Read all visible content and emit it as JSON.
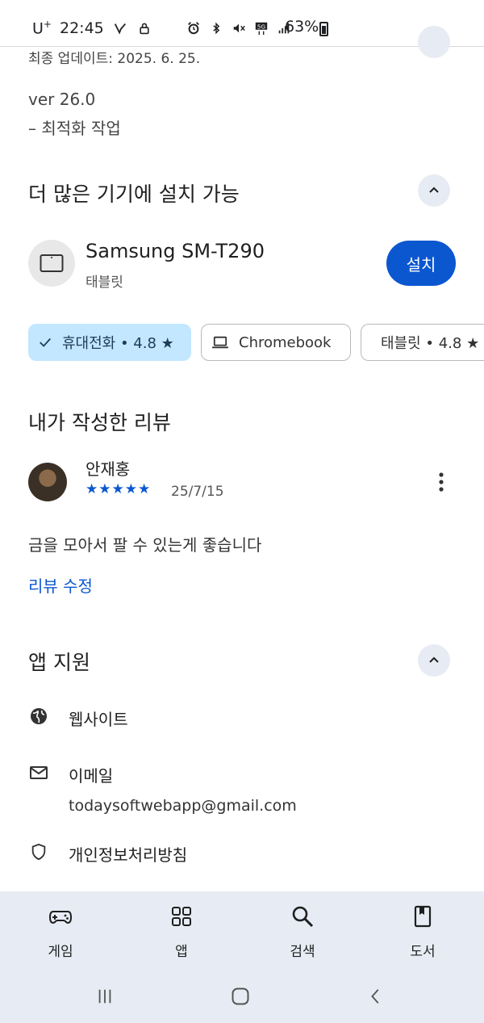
{
  "status_bar": {
    "carrier": "U",
    "carrier_sup": "+",
    "time": "22:45",
    "battery": "63%"
  },
  "last_update": "최종 업데이트: 2025. 6. 25.",
  "whats_new": {
    "version": "ver 26.0",
    "note": "– 최적화 작업"
  },
  "more_devices": {
    "title": "더 많은 기기에 설치 가능",
    "device_name": "Samsung SM-T290",
    "device_type": "태블릿",
    "install_label": "설치",
    "chips": [
      {
        "label": "휴대전화 • 4.8 ★",
        "selected": true,
        "icon": "check-icon"
      },
      {
        "label": "Chromebook",
        "selected": false,
        "icon": "laptop-icon"
      },
      {
        "label": "태블릿 • 4.8 ★",
        "selected": false,
        "icon": "tablet-icon"
      }
    ]
  },
  "my_review": {
    "title": "내가 작성한 리뷰",
    "reviewer": "안재홍",
    "rating": 5,
    "stars": "★★★★★",
    "date": "25/7/15",
    "text": "금을 모아서 팔 수 있는게 좋습니다",
    "edit_label": "리뷰 수정"
  },
  "app_support": {
    "title": "앱 지원",
    "website_label": "웹사이트",
    "email_label": "이메일",
    "email_value": "todaysoftwebapp@gmail.com",
    "privacy_label": "개인정보처리방침"
  },
  "bottom_nav": [
    {
      "label": "게임",
      "icon": "gamepad-icon"
    },
    {
      "label": "앱",
      "icon": "apps-grid-icon"
    },
    {
      "label": "검색",
      "icon": "search-icon"
    },
    {
      "label": "도서",
      "icon": "book-icon"
    }
  ],
  "colors": {
    "accent": "#0b57d0",
    "chip_selected": "#c2e7ff",
    "nav_background": "#e7ecf4"
  }
}
